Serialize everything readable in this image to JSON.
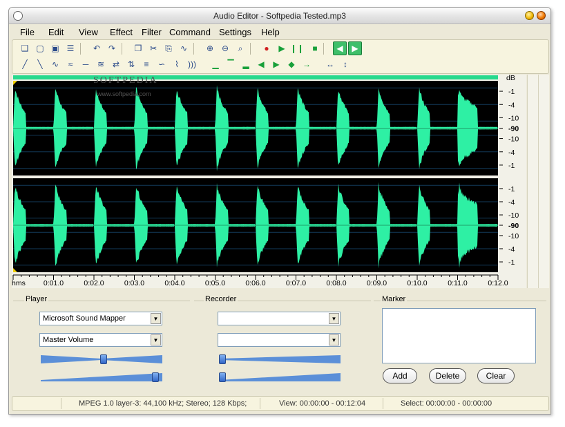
{
  "window": {
    "title": "Audio Editor - Softpedia Tested.mp3"
  },
  "menu": {
    "items": [
      {
        "label": "File"
      },
      {
        "label": "Edit"
      },
      {
        "label": "View"
      },
      {
        "label": "Effect"
      },
      {
        "label": "Filter"
      },
      {
        "label": "Command"
      },
      {
        "label": "Settings"
      },
      {
        "label": "Help"
      }
    ]
  },
  "toolbar": {
    "row1": [
      {
        "icon": "new-file-icon",
        "glyph": "❑"
      },
      {
        "icon": "open-folder-icon",
        "glyph": "▢"
      },
      {
        "icon": "save-icon",
        "glyph": "▣"
      },
      {
        "icon": "properties-icon",
        "glyph": "☰"
      },
      {
        "icon": "undo-icon",
        "glyph": "↶"
      },
      {
        "icon": "redo-icon",
        "glyph": "↷"
      },
      {
        "icon": "copy-icon",
        "glyph": "❐"
      },
      {
        "icon": "cut-icon",
        "glyph": "✂"
      },
      {
        "icon": "paste-icon",
        "glyph": "⎘"
      },
      {
        "icon": "paste-mix-icon",
        "glyph": "∿"
      },
      {
        "icon": "zoom-in-icon",
        "glyph": "⊕"
      },
      {
        "icon": "zoom-out-icon",
        "glyph": "⊖"
      },
      {
        "icon": "zoom-full-icon",
        "glyph": "⌕"
      },
      {
        "icon": "record-icon",
        "glyph": "●"
      },
      {
        "icon": "play-icon",
        "glyph": "▶"
      },
      {
        "icon": "pause-icon",
        "glyph": "❙❙"
      },
      {
        "icon": "stop-icon",
        "glyph": "■"
      },
      {
        "icon": "left-channel-icon",
        "glyph": "◀"
      },
      {
        "icon": "right-channel-icon",
        "glyph": "▶"
      }
    ],
    "row2": [
      {
        "icon": "fade-in-icon",
        "glyph": "╱"
      },
      {
        "icon": "fade-out-icon",
        "glyph": "╲"
      },
      {
        "icon": "amplify-icon",
        "glyph": "∿"
      },
      {
        "icon": "normalize-icon",
        "glyph": "≈"
      },
      {
        "icon": "silence-icon",
        "glyph": "─"
      },
      {
        "icon": "echo-icon",
        "glyph": "≋"
      },
      {
        "icon": "reverse-icon",
        "glyph": "⇄"
      },
      {
        "icon": "invert-icon",
        "glyph": "⇅"
      },
      {
        "icon": "equalizer-icon",
        "glyph": "≡"
      },
      {
        "icon": "flanger-icon",
        "glyph": "∽"
      },
      {
        "icon": "vibrato-icon",
        "glyph": "⌇"
      },
      {
        "icon": "tremolo-icon",
        "glyph": ")))"
      },
      {
        "icon": "lowpass-icon",
        "glyph": "▁"
      },
      {
        "icon": "highpass-icon",
        "glyph": "▔"
      },
      {
        "icon": "bandpass-icon",
        "glyph": "▂"
      },
      {
        "icon": "go-start-icon",
        "glyph": "◀"
      },
      {
        "icon": "go-end-icon",
        "glyph": "▶"
      },
      {
        "icon": "center-icon",
        "glyph": "◆"
      },
      {
        "icon": "mark-icon",
        "glyph": "→"
      },
      {
        "icon": "split-icon",
        "glyph": "↔"
      },
      {
        "icon": "merge-icon",
        "glyph": "↕"
      }
    ]
  },
  "waveform": {
    "db_header": "dB",
    "channel_scale": [
      "-1",
      "-4",
      "-10",
      "-90",
      "-10",
      "-4",
      "-1"
    ],
    "lower_scale": [
      "-1",
      "-4",
      "-10",
      "-90",
      "-10",
      "-4",
      "-1"
    ],
    "time_unit": "hms",
    "time_ticks": [
      "0:01.0",
      "0:02.0",
      "0:03.0",
      "0:04.0",
      "0:05.0",
      "0:06.0",
      "0:07.0",
      "0:08.0",
      "0:09.0",
      "0:10.0",
      "0:11.0",
      "0:12.0"
    ],
    "watermark": "SOFTPEDIA",
    "watermark_url": "www.softpedia.com",
    "colors": {
      "wave": "#2ef0a4",
      "background": "#000000",
      "bar": "#27d98d"
    }
  },
  "player": {
    "label": "Player",
    "device": "Microsoft Sound Mapper",
    "volume_source": "Master Volume",
    "slider1": 0.52,
    "slider2": 0.97
  },
  "recorder": {
    "label": "Recorder",
    "device": "",
    "source": "",
    "slider1": 0.0,
    "slider2": 0.0
  },
  "marker": {
    "label": "Marker",
    "add_label": "Add",
    "delete_label": "Delete",
    "clear_label": "Clear"
  },
  "status": {
    "format": "MPEG 1.0 layer-3: 44,100 kHz; Stereo; 128 Kbps;",
    "view": "View: 00:00:00 - 00:12:04",
    "select": "Select: 00:00:00 - 00:00:00"
  }
}
